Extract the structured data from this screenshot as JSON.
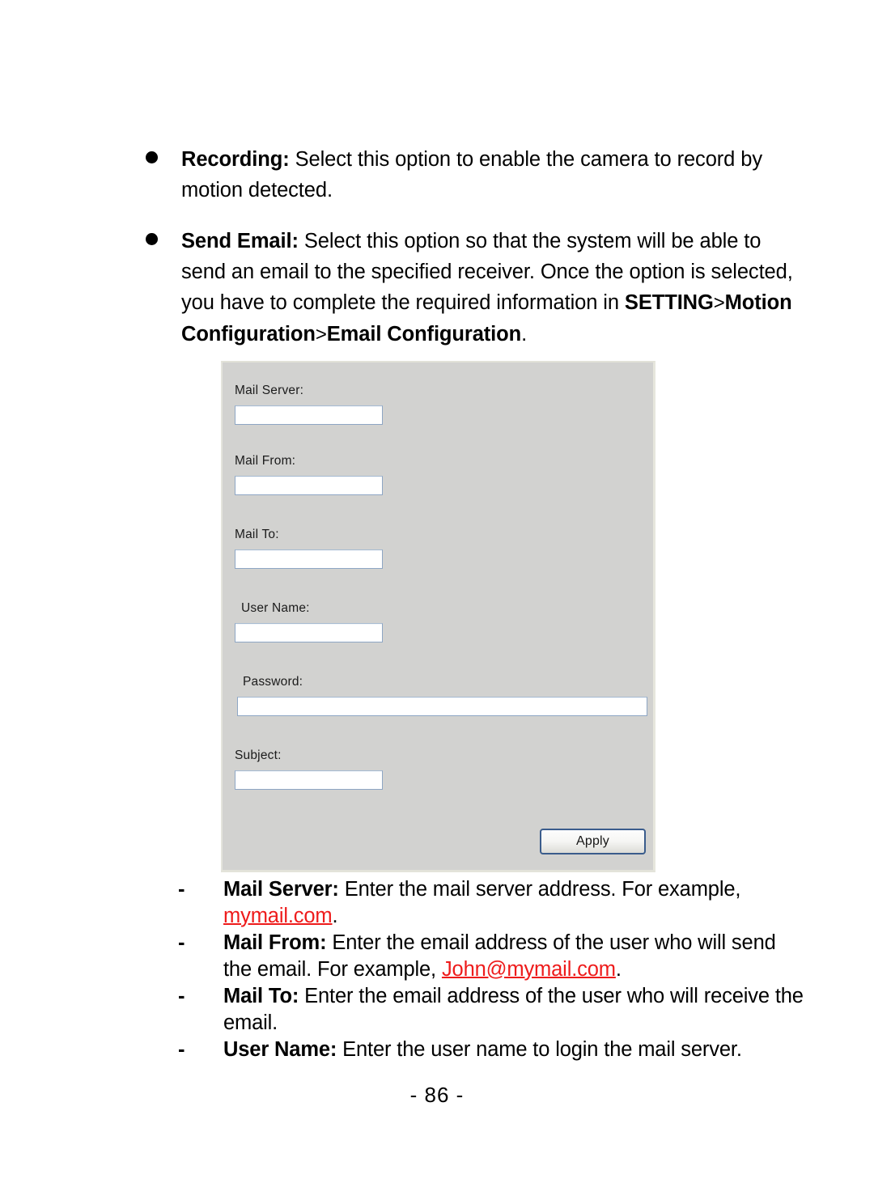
{
  "page": {
    "number_label": "- 86 -",
    "background": "#ffffff"
  },
  "bullets": [
    {
      "marker": "bullet-dot",
      "term": "Recording:",
      "text": " Select this option to enable the camera to record by motion detected."
    },
    {
      "marker": "bullet-dot",
      "term": "Send Email:",
      "text_part1": " Select this option so that the system will be able to send an email to the specified receiver.  Once the option is selected, you have to complete the required information in ",
      "path_1": "SETTING",
      "path_sep_1": ">",
      "path_2": "Motion Configuration",
      "path_sep_2": ">",
      "path_3": "Email Configuration",
      "text_end": "."
    }
  ],
  "dialog": {
    "name": "Email Configuration",
    "background_color": "#d2d2d0",
    "field_border_color": "#8ea6c4",
    "fields": [
      {
        "label": "Mail Server:",
        "value": "",
        "placeholder": ""
      },
      {
        "label": "Mail From:",
        "value": "",
        "placeholder": ""
      },
      {
        "label": "Mail To:",
        "value": "",
        "placeholder": ""
      },
      {
        "label": "User Name:",
        "value": "",
        "placeholder": ""
      },
      {
        "label": "Password:",
        "value": "",
        "placeholder": ""
      },
      {
        "label": "Subject:",
        "value": "",
        "placeholder": ""
      }
    ],
    "apply_label": "Apply"
  },
  "descriptions": [
    {
      "marker": "-",
      "term": "Mail Server:",
      "text_before": "  Enter the mail server address.  For example, ",
      "link": "mymail.com",
      "text_after": "."
    },
    {
      "marker": "-",
      "term": "Mail From:",
      "text_before": "  Enter the email address of the user who will send the email.  For example, ",
      "link": "John@mymail.com",
      "text_after": "."
    },
    {
      "marker": "-",
      "term": "Mail To:",
      "text_before": "  Enter the email address of the user who will receive the email.",
      "link": "",
      "text_after": ""
    },
    {
      "marker": "-",
      "term": "User Name:",
      "text_before": "  Enter the user name to login the mail server.",
      "link": "",
      "text_after": ""
    }
  ],
  "colors": {
    "link_red": "#ee1b1b",
    "dialog_gray": "#d2d2d0",
    "button_border_blue": "#3a5c8c"
  }
}
